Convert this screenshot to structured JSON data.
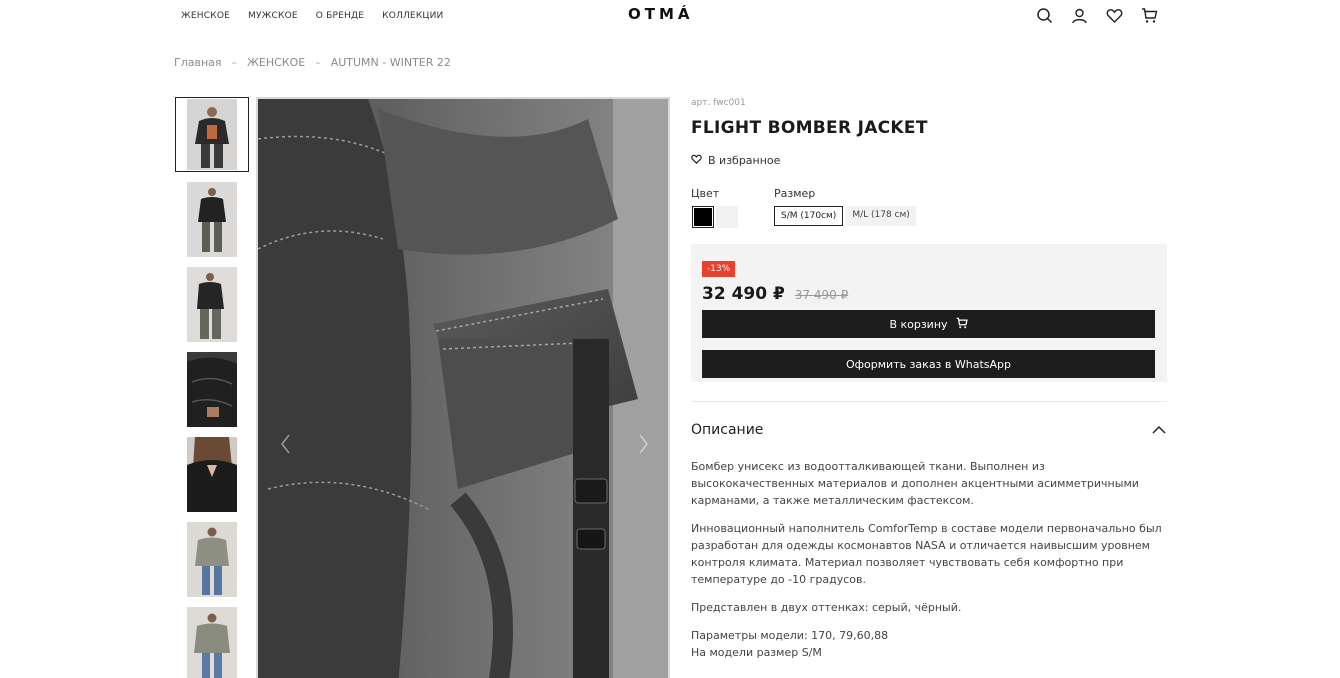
{
  "header": {
    "nav": [
      "ЖЕНСКОЕ",
      "МУЖСКОЕ",
      "О БРЕНДЕ",
      "КОЛЛЕКЦИИ"
    ],
    "logo": "OTMÁ",
    "icons": [
      "search-icon",
      "user-icon",
      "heart-icon",
      "cart-icon"
    ]
  },
  "breadcrumb": {
    "items": [
      "Главная",
      "ЖЕНСКОЕ",
      "AUTUMN - WINTER 22"
    ],
    "separator": "–"
  },
  "gallery": {
    "thumb_count": 7,
    "active_index": 0
  },
  "product": {
    "sku": "арт. fwc001",
    "title": "FLIGHT BOMBER JACKET",
    "favorite_label": "В избранное",
    "color_label": "Цвет",
    "colors": [
      "#000000",
      "#f1f1f1"
    ],
    "size_label": "Размер",
    "sizes": [
      "S/M (170см)",
      "M/L (178 см)"
    ],
    "selected_size": "S/M (170см)",
    "discount": "-13%",
    "price": "32 490 ₽",
    "old_price": "37 490 ₽",
    "cart_button": "В корзину",
    "whatsapp_button": "Оформить заказ в WhatsApp"
  },
  "description": {
    "title": "Описание",
    "paragraphs": [
      "Бомбер унисекс из водоотталкивающей ткани. Выполнен из высококачественных материалов и дополнен акцентными асимметричными карманами, а также металлическим фастексом.",
      "Инновационный наполнитель ComforTemp в составе модели первоначально был разработан для одежды космонавтов NASA и отличается наивысшим уровнем контроля климата. Материал позволяет чувствовать себя комфортно при температуре до -10 градусов.",
      "Представлен в двух оттенках: серый, чёрный.",
      "Параметры модели: 170, 79,60,88",
      "На модели размер S/M"
    ]
  },
  "colors": {
    "accent_discount": "#e8412c",
    "button_bg": "#1d1d1d",
    "buybox_bg": "#f3f3f3"
  }
}
